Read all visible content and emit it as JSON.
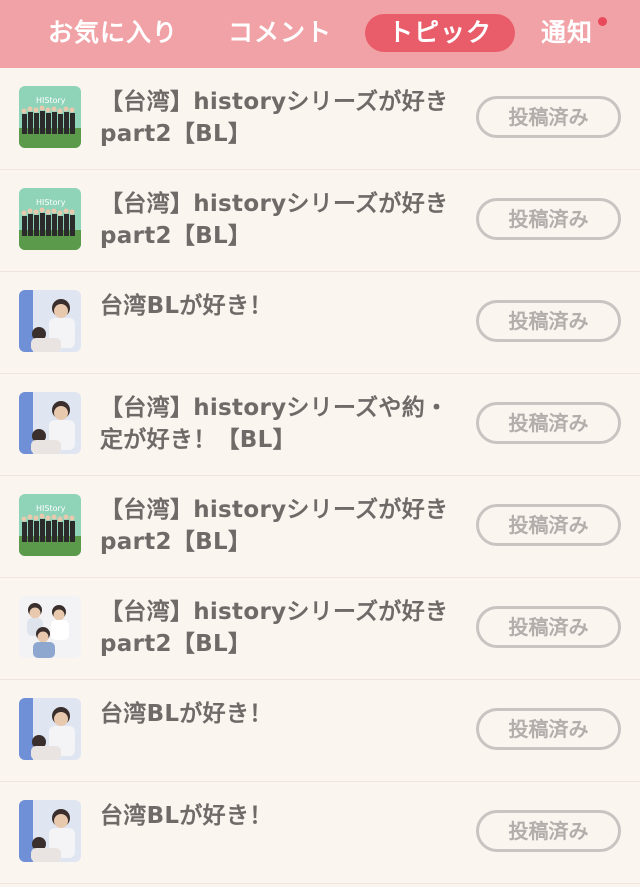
{
  "tabs": [
    {
      "label": "お気に入り"
    },
    {
      "label": "コメント"
    },
    {
      "label": "トピック"
    },
    {
      "label": "通知"
    }
  ],
  "items": [
    {
      "title": "【台湾】historyシリーズが好き part2【BL】",
      "status": "投稿済み",
      "thumb_icon": "group-photo-history-icon"
    },
    {
      "title": "【台湾】historyシリーズが好き part2【BL】",
      "status": "投稿済み",
      "thumb_icon": "group-photo-history-icon"
    },
    {
      "title": "台湾BLが好き！",
      "status": "投稿済み",
      "thumb_icon": "couple-photo-icon"
    },
    {
      "title": "【台湾】historyシリーズや約・定が好き！【BL】",
      "status": "投稿済み",
      "thumb_icon": "couple-photo-icon"
    },
    {
      "title": "【台湾】historyシリーズが好き part2【BL】",
      "status": "投稿済み",
      "thumb_icon": "group-photo-history-icon"
    },
    {
      "title": "【台湾】historyシリーズが好き part2【BL】",
      "status": "投稿済み",
      "thumb_icon": "trio-photo-icon"
    },
    {
      "title": "台湾BLが好き！",
      "status": "投稿済み",
      "thumb_icon": "couple-photo-icon"
    },
    {
      "title": "台湾BLが好き！",
      "status": "投稿済み",
      "thumb_icon": "couple-photo-icon"
    }
  ],
  "colors": {
    "header": "#f1a2a6",
    "active_tab": "#e95d6a",
    "badge_dot": "#e84a5b",
    "background": "#fbf5f0"
  }
}
